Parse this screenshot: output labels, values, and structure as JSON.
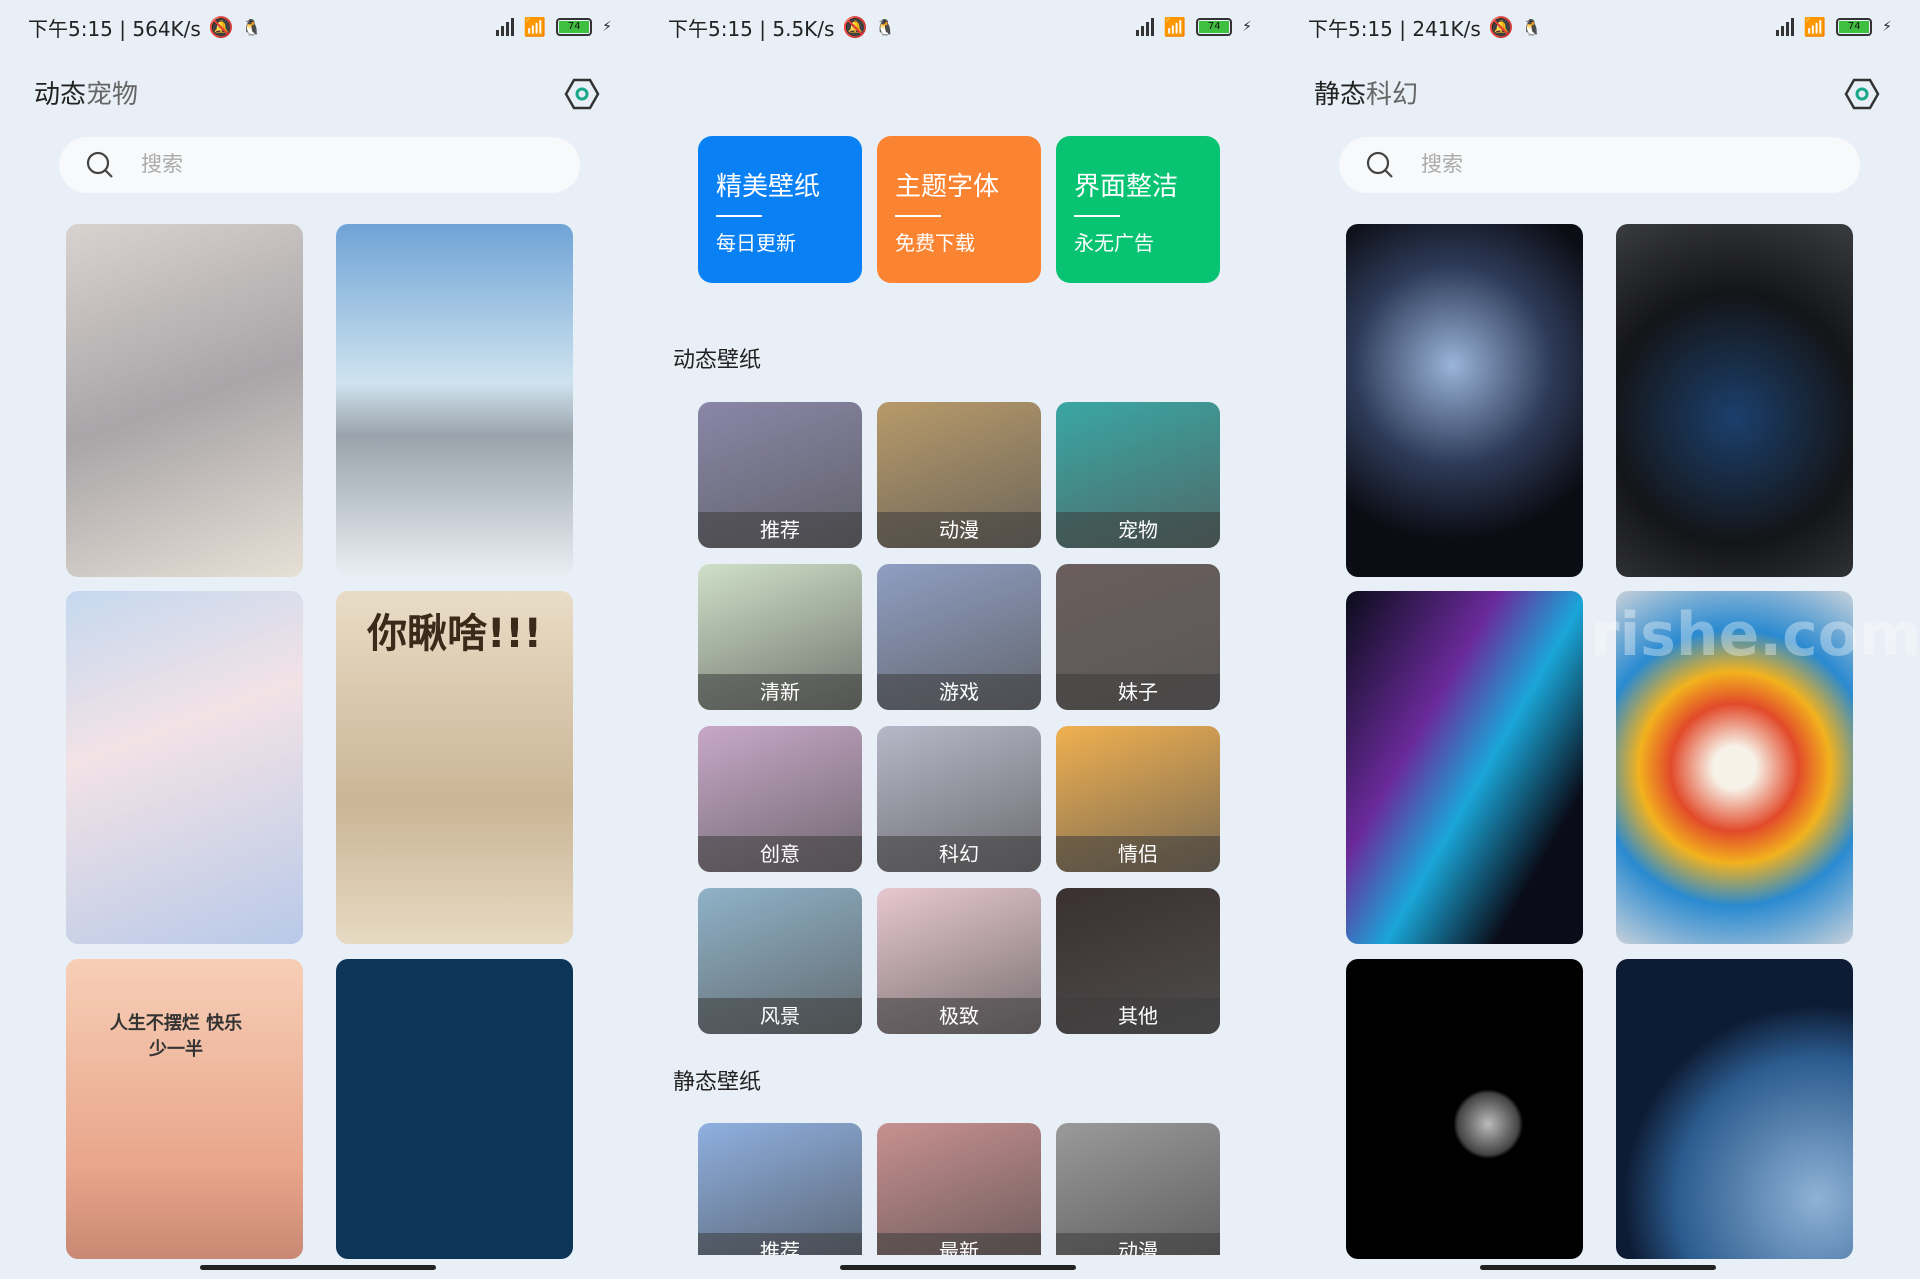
{
  "screens": [
    {
      "status": {
        "time": "下午5:15 | 564K/s",
        "battery": "74"
      },
      "title": {
        "main": "动态",
        "sub": "宠物"
      },
      "search": {
        "placeholder": "搜索"
      }
    },
    {
      "status": {
        "time": "下午5:15 | 5.5K/s",
        "battery": "74"
      }
    },
    {
      "status": {
        "time": "下午5:15 | 241K/s",
        "battery": "74"
      },
      "title": {
        "main": "静态",
        "sub": "科幻"
      },
      "search": {
        "placeholder": "搜索"
      }
    }
  ],
  "promos": [
    {
      "title": "精美壁纸",
      "subtitle": "每日更新",
      "color": "#0a80f5"
    },
    {
      "title": "主题字体",
      "subtitle": "免费下载",
      "color": "#fb8432"
    },
    {
      "title": "界面整洁",
      "subtitle": "永无广告",
      "color": "#08c472"
    }
  ],
  "dynamic_section": {
    "label": "动态壁纸",
    "categories": [
      "推荐",
      "动漫",
      "宠物",
      "清新",
      "游戏",
      "妹子",
      "创意",
      "科幻",
      "情侣",
      "风景",
      "极致",
      "其他"
    ]
  },
  "static_section": {
    "label": "静态壁纸",
    "categories": [
      "推荐",
      "最新",
      "动漫"
    ]
  },
  "pet_cards": [
    {
      "caption": ""
    },
    {
      "caption": ""
    },
    {
      "caption": ""
    },
    {
      "caption": "你瞅啥!!!"
    },
    {
      "caption": "人生不摆烂 快乐少一半"
    },
    {
      "caption": ""
    }
  ],
  "watermark": "rishe.com",
  "accent": "#1aa88a"
}
